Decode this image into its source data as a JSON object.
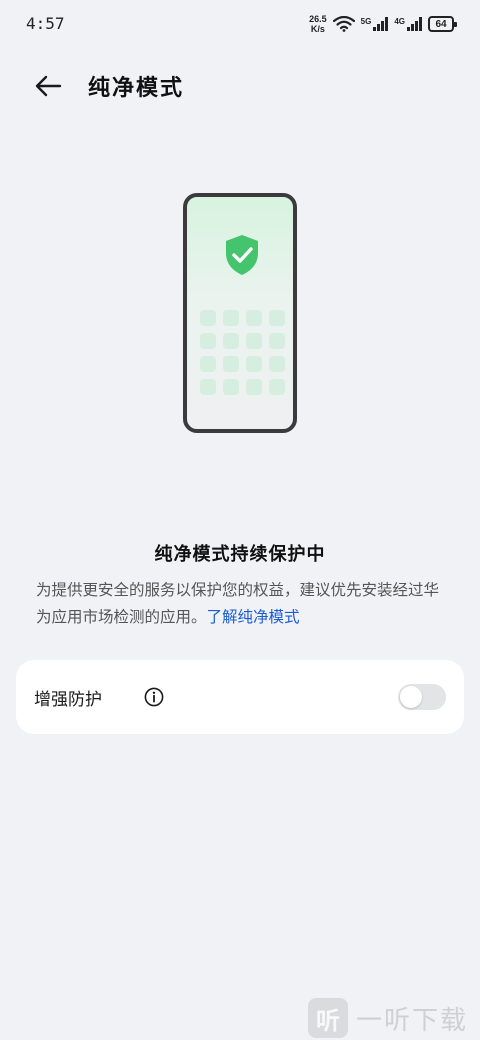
{
  "status_bar": {
    "time": "4:57",
    "net_speed_value": "26.5",
    "net_speed_unit": "K/s",
    "signal_1_label": "5G",
    "signal_2_label": "4G",
    "battery": "64",
    "icons": [
      "wifi-icon",
      "signal-icon",
      "battery-icon"
    ]
  },
  "header": {
    "title": "纯净模式",
    "back_icon": "back-arrow-icon"
  },
  "illustration": {
    "icon": "shield-check-icon",
    "accent_color": "#45c46e"
  },
  "protection": {
    "title": "纯净模式持续保护中",
    "description": "为提供更安全的服务以保护您的权益，建议优先安装经过华为应用市场检测的应用。",
    "link_text": "了解纯净模式",
    "link_color": "#1a5bd6"
  },
  "enhanced": {
    "label": "增强防护",
    "info_icon": "info-icon",
    "toggle_on": false
  },
  "watermark": {
    "logo_char": "听",
    "text": "一听下载"
  }
}
